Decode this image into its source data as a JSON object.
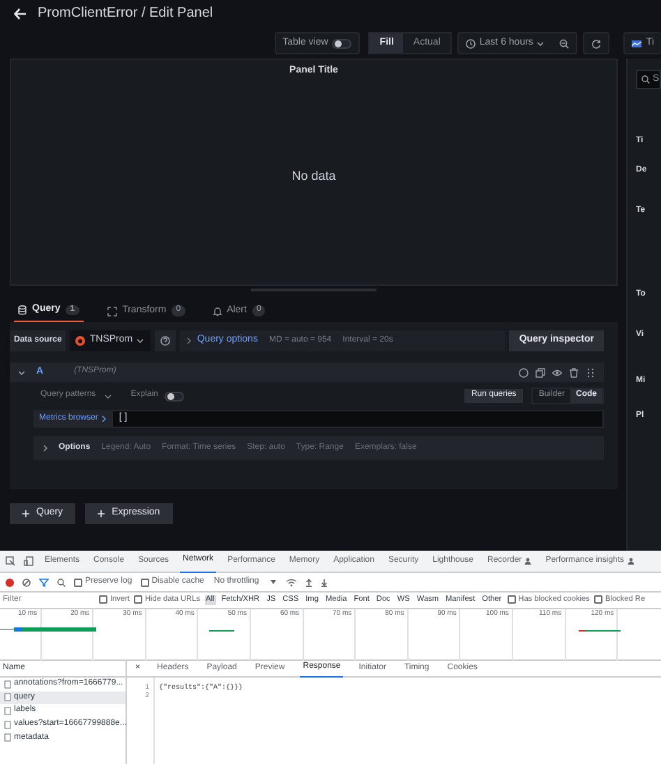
{
  "header": {
    "title": "PromClientError / Edit Panel"
  },
  "toolbar": {
    "table_view": {
      "label": "Table view",
      "on": false
    },
    "view_modes": [
      {
        "label": "Fill",
        "selected": true
      },
      {
        "label": "Actual",
        "selected": false
      }
    ],
    "time_range": "Last 6 hours",
    "cut_button": "Ti"
  },
  "panel": {
    "title": "Panel Title",
    "message": "No data"
  },
  "query_tabs": [
    {
      "label": "Query",
      "count": "1",
      "selected": true
    },
    {
      "label": "Transform",
      "count": "0",
      "selected": false
    },
    {
      "label": "Alert",
      "count": "0",
      "selected": false
    }
  ],
  "data_source": {
    "label": "Data source",
    "name": "TNSProm",
    "query_options": "Query options",
    "md": "MD = auto = 954",
    "interval": "Interval = 20s",
    "inspector": "Query inspector"
  },
  "query": {
    "ref": "A",
    "source": "(TNSProm)",
    "patterns": "Query patterns",
    "explain": {
      "label": "Explain",
      "on": false
    },
    "run": "Run queries",
    "modes": [
      {
        "label": "Builder",
        "selected": false
      },
      {
        "label": "Code",
        "selected": true
      }
    ],
    "metrics_browser": "Metrics browser",
    "expression": "[ ]",
    "options_label": "Options",
    "options": [
      "Legend: Auto",
      "Format: Time series",
      "Step: auto",
      "Type: Range",
      "Exemplars: false"
    ]
  },
  "add_buttons": [
    "Query",
    "Expression"
  ],
  "sidebar": {
    "search_placeholder": "S",
    "labels": [
      "Ti",
      "De",
      "Te",
      "To",
      "Vi",
      "Mi",
      "Pl"
    ]
  },
  "devtools": {
    "tabs": [
      {
        "label": "Elements",
        "selected": false
      },
      {
        "label": "Console",
        "selected": false
      },
      {
        "label": "Sources",
        "selected": false
      },
      {
        "label": "Network",
        "selected": true
      },
      {
        "label": "Performance",
        "selected": false
      },
      {
        "label": "Memory",
        "selected": false
      },
      {
        "label": "Application",
        "selected": false
      },
      {
        "label": "Security",
        "selected": false
      },
      {
        "label": "Lighthouse",
        "selected": false
      },
      {
        "label": "Recorder",
        "selected": false
      },
      {
        "label": "Performance insights",
        "selected": false
      }
    ],
    "checks": [
      {
        "label": "Preserve log",
        "checked": false
      },
      {
        "label": "Disable cache",
        "checked": false
      }
    ],
    "throttling": "No throttling",
    "filter_placeholder": "Filter",
    "filter_checks": [
      {
        "label": "Invert",
        "checked": false
      },
      {
        "label": "Hide data URLs",
        "checked": false
      }
    ],
    "types": [
      {
        "label": "All",
        "selected": true
      },
      {
        "label": "Fetch/XHR",
        "selected": false
      },
      {
        "label": "JS",
        "selected": false
      },
      {
        "label": "CSS",
        "selected": false
      },
      {
        "label": "Img",
        "selected": false
      },
      {
        "label": "Media",
        "selected": false
      },
      {
        "label": "Font",
        "selected": false
      },
      {
        "label": "Doc",
        "selected": false
      },
      {
        "label": "WS",
        "selected": false
      },
      {
        "label": "Wasm",
        "selected": false
      },
      {
        "label": "Manifest",
        "selected": false
      },
      {
        "label": "Other",
        "selected": false
      }
    ],
    "extra_checks": [
      {
        "label": "Has blocked cookies",
        "checked": false
      },
      {
        "label": "Blocked Re",
        "checked": false
      }
    ],
    "ticks": [
      "10 ms",
      "20 ms",
      "30 ms",
      "40 ms",
      "50 ms",
      "60 ms",
      "70 ms",
      "80 ms",
      "90 ms",
      "100 ms",
      "110 ms",
      "120 ms"
    ],
    "name_header": "Name",
    "requests": [
      {
        "name": "annotations?from=1666779...",
        "selected": false
      },
      {
        "name": "query",
        "selected": true
      },
      {
        "name": "labels",
        "selected": false
      },
      {
        "name": "values?start=16667799888e...",
        "selected": false
      },
      {
        "name": "metadata",
        "selected": false
      }
    ],
    "detail_tabs": [
      {
        "label": "Headers",
        "selected": false
      },
      {
        "label": "Payload",
        "selected": false
      },
      {
        "label": "Preview",
        "selected": false
      },
      {
        "label": "Response",
        "selected": true
      },
      {
        "label": "Initiator",
        "selected": false
      },
      {
        "label": "Timing",
        "selected": false
      },
      {
        "label": "Cookies",
        "selected": false
      }
    ],
    "close": "×",
    "response_lines": [
      {
        "number": "1",
        "code": "{\"results\":{\"A\":{}}}"
      },
      {
        "number": "2"
      }
    ]
  }
}
